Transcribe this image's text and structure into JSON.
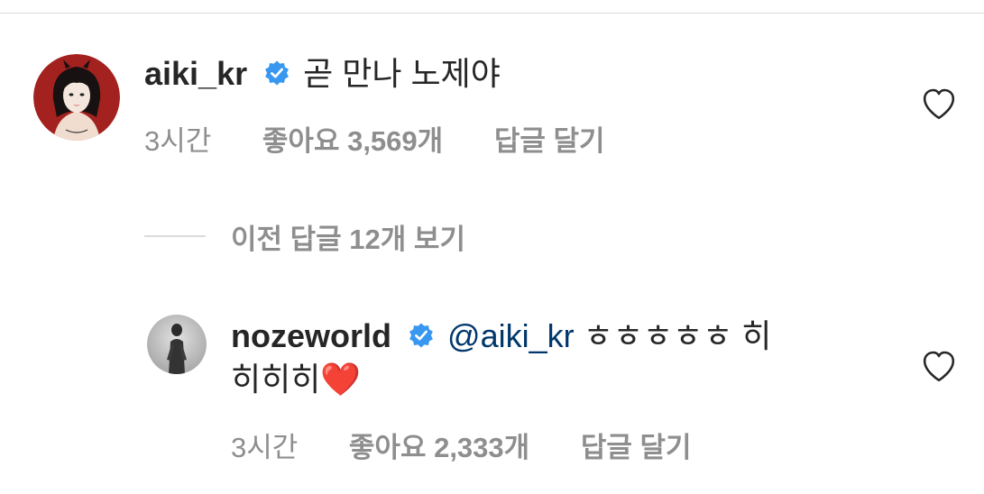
{
  "comments": [
    {
      "username": "aiki_kr",
      "verified": true,
      "text": "곧 만나 노제야",
      "time": "3시간",
      "likes": "좋아요 3,569개",
      "reply": "답글 달기"
    },
    {
      "username": "nozeworld",
      "verified": true,
      "mention": "@aiki_kr",
      "text_line1": "ㅎㅎㅎㅎㅎ 히",
      "text_line2": "히히히",
      "emoji": "❤️",
      "time": "3시간",
      "likes": "좋아요 2,333개",
      "reply": "답글 달기"
    }
  ],
  "view_previous_replies": "이전 답글 12개 보기",
  "colors": {
    "text": "#262626",
    "secondary": "#8e8e8e",
    "mention": "#00376b",
    "verified": "#3897f0",
    "divider": "#dbdbdb"
  },
  "icons": {
    "verified": "verified-badge-icon",
    "like": "heart-outline-icon"
  }
}
